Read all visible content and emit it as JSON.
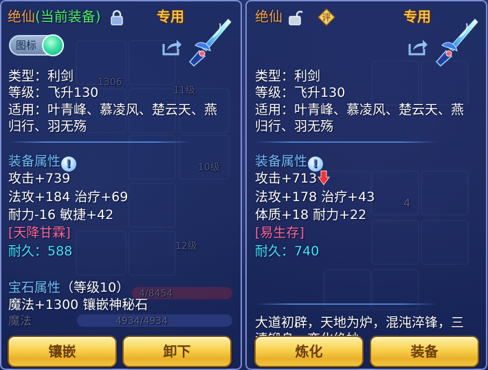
{
  "left": {
    "name": "绝仙",
    "equipped_tag": "(当前装备)",
    "dedicated": "专用",
    "toggle_label": "图标",
    "type": "类型：利剑",
    "level": "等级：飞升130",
    "usage_1": "适用：叶青峰、慕凌风、楚云天、燕",
    "usage_2": "归行、羽无殇",
    "equip_attr_title": "装备属性",
    "attack": "攻击+739",
    "line2": "法攻+184 治疗+69",
    "line3": "耐力-16 敏捷+42",
    "special": "[天降甘霖]",
    "durability_label": "耐久：",
    "durability_value": "588",
    "gem_title": "宝石属性",
    "gem_level": "（等级10）",
    "gem_line": "魔法+1300 镶嵌神秘石",
    "btn_inlay": "镶嵌",
    "btn_unequip": "卸下"
  },
  "right": {
    "name": "绝仙",
    "dedicated": "专用",
    "badge": "评",
    "type": "类型：利剑",
    "level": "等级：飞升130",
    "usage_1": "适用：叶青峰、慕凌风、楚云天、燕",
    "usage_2": "归行、羽无殇",
    "equip_attr_title": "装备属性",
    "attack": "攻击+713",
    "line2": "法攻+178 治疗+43",
    "line3": "体质+18 耐力+22",
    "special": "[易生存]",
    "durability_label": "耐久：",
    "durability_value": "740",
    "desc_1": "大道初辟，天地为炉，混沌淬锋，三",
    "desc_2": "清锻身，变化绝妙",
    "btn_refine": "炼化",
    "btn_equip": "装备"
  },
  "background": {
    "level_11": "11级",
    "level_10": "10级",
    "level_12": "12级",
    "hp_text": "1306",
    "mana_label": "魔法",
    "mana_value": "4934/4934",
    "hp_bar": "4/8454",
    "count_4": "4"
  },
  "colors": {
    "name": "#f4a64a",
    "equipped": "#4ef06a",
    "section": "#70c0ff",
    "special": "#ff6aa0",
    "durability": "#43e6ff",
    "button": "#f8d04e"
  },
  "icons": [
    "lock-icon",
    "unlock-icon",
    "share-icon",
    "sword-icon",
    "info-icon",
    "down-arrow-icon",
    "rating-badge-icon",
    "toggle-switch"
  ]
}
